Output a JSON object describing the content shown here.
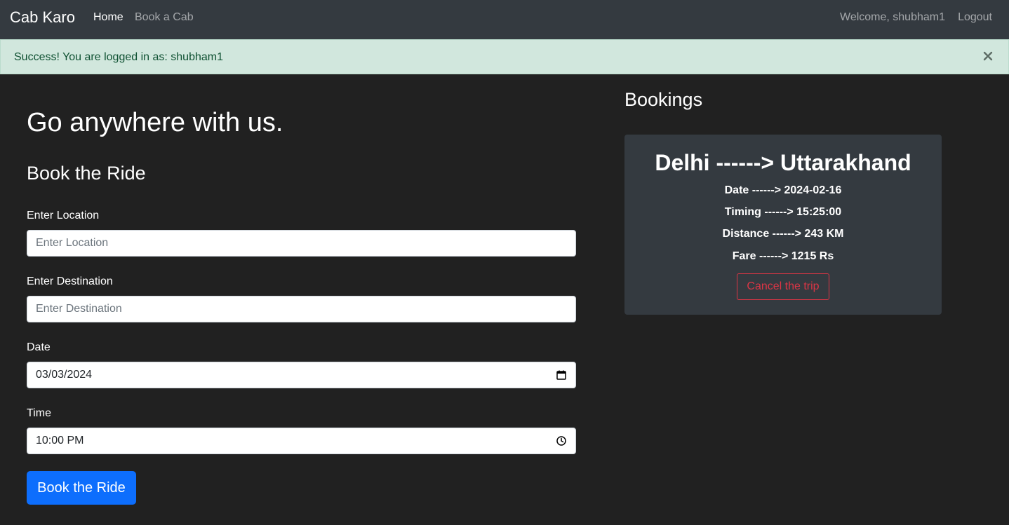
{
  "navbar": {
    "brand": "Cab Karo",
    "links": {
      "home": "Home",
      "book": "Book a Cab"
    },
    "welcome": "Welcome, shubham1",
    "logout": "Logout"
  },
  "alert": {
    "message": "Success! You are logged in as: shubham1",
    "close_icon": "close-icon"
  },
  "main": {
    "hero": "Go anywhere with us.",
    "form_title": "Book the Ride",
    "fields": {
      "location": {
        "label": "Enter Location",
        "placeholder": "Enter Location",
        "value": ""
      },
      "destination": {
        "label": "Enter Destination",
        "placeholder": "Enter Destination",
        "value": ""
      },
      "date": {
        "label": "Date",
        "value": "03/03/2024",
        "icon": "calendar-icon"
      },
      "time": {
        "label": "Time",
        "value": "10:00 PM",
        "icon": "clock-icon"
      }
    },
    "submit_label": "Book the Ride"
  },
  "bookings": {
    "title": "Bookings",
    "items": [
      {
        "route": "Delhi ------> Uttarakhand",
        "date": "Date ------> 2024-02-16",
        "timing": "Timing ------> 15:25:00",
        "distance": "Distance ------> 243 KM",
        "fare": "Fare ------> 1215 Rs",
        "cancel_label": "Cancel the trip"
      }
    ]
  },
  "colors": {
    "background": "#212121",
    "navbar": "#343a40",
    "alert_bg": "#d1e7dd",
    "alert_text": "#0f5132",
    "primary": "#0d6efd",
    "danger": "#dc3545"
  }
}
